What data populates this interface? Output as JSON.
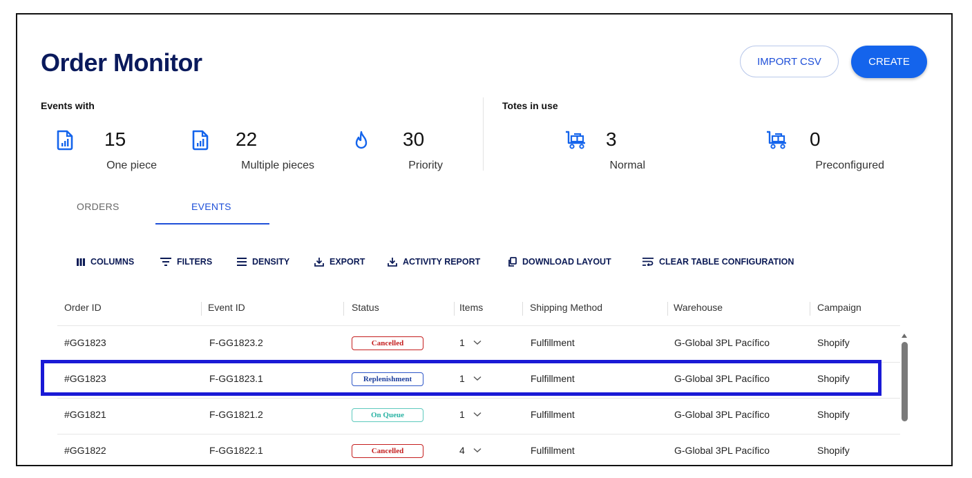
{
  "header": {
    "title": "Order Monitor",
    "import_label": "IMPORT CSV",
    "create_label": "CREATE"
  },
  "events_section": {
    "label": "Events with",
    "stats": [
      {
        "value": "15",
        "label": "One piece",
        "icon": "document-chart-icon"
      },
      {
        "value": "22",
        "label": "Multiple pieces",
        "icon": "document-chart-icon"
      },
      {
        "value": "30",
        "label": "Priority",
        "icon": "flame-icon"
      }
    ]
  },
  "totes_section": {
    "label": "Totes in use",
    "stats": [
      {
        "value": "3",
        "label": "Normal",
        "icon": "cart-icon"
      },
      {
        "value": "0",
        "label": "Preconfigured",
        "icon": "cart-icon"
      }
    ]
  },
  "tabs": [
    {
      "label": "ORDERS",
      "active": false
    },
    {
      "label": "EVENTS",
      "active": true
    }
  ],
  "toolbar": {
    "columns": "COLUMNS",
    "filters": "FILTERS",
    "density": "DENSITY",
    "export": "EXPORT",
    "activity_report": "ACTIVITY REPORT",
    "download_layout": "DOWNLOAD LAYOUT",
    "clear_config": "CLEAR TABLE CONFIGURATION"
  },
  "table": {
    "columns": [
      "Order ID",
      "Event ID",
      "Status",
      "Items",
      "Shipping Method",
      "Warehouse",
      "Campaign"
    ],
    "rows": [
      {
        "order_id": "#GG1823",
        "event_id": "F-GG1823.2",
        "status": "Cancelled",
        "items": "1",
        "shipping": "Fulfillment",
        "warehouse": "G-Global 3PL Pacífico",
        "campaign": "Shopify"
      },
      {
        "order_id": "#GG1823",
        "event_id": "F-GG1823.1",
        "status": "Replenishment",
        "items": "1",
        "shipping": "Fulfillment",
        "warehouse": "G-Global 3PL Pacífico",
        "campaign": "Shopify"
      },
      {
        "order_id": "#GG1821",
        "event_id": "F-GG1821.2",
        "status": "On Queue",
        "items": "1",
        "shipping": "Fulfillment",
        "warehouse": "G-Global 3PL Pacífico",
        "campaign": "Shopify"
      },
      {
        "order_id": "#GG1822",
        "event_id": "F-GG1822.1",
        "status": "Cancelled",
        "items": "4",
        "shipping": "Fulfillment",
        "warehouse": "G-Global 3PL Pacífico",
        "campaign": "Shopify"
      }
    ]
  },
  "colors": {
    "brand_navy": "#0a1a5c",
    "primary_blue": "#1464ec",
    "highlight": "#1a1ad6",
    "cancelled": "#c41d1d",
    "replenishment": "#1e3f9d",
    "on_queue": "#2bb3a4"
  }
}
